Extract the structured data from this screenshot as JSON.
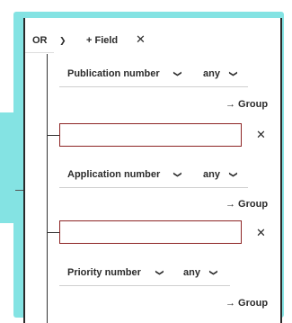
{
  "header": {
    "operator": "OR",
    "add_field_label": "+ Field",
    "remove_symbol": "✕"
  },
  "rows": [
    {
      "field": "Publication number",
      "operator": "any",
      "group_label": "→ Group",
      "value": ""
    },
    {
      "field": "Application number",
      "operator": "any",
      "group_label": "→ Group",
      "value": ""
    },
    {
      "field": "Priority number",
      "operator": "any",
      "group_label": "→ Group",
      "value": ""
    }
  ],
  "icons": {
    "dropdown": "chevron-down-icon",
    "remove": "close-icon",
    "arrow": "arrow-right-icon"
  },
  "colors": {
    "frame": "#84e3e3",
    "input_border": "#8d2424",
    "text": "#2b2b2b"
  }
}
